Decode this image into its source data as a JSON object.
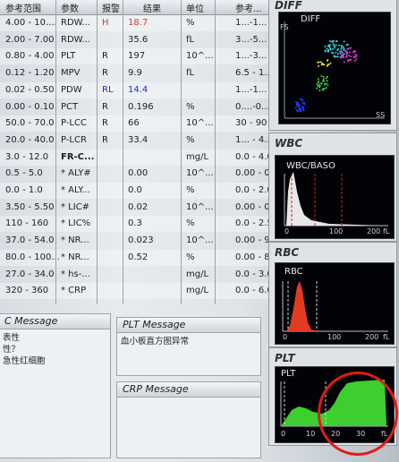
{
  "table": {
    "headers": {
      "range": "参考范围",
      "param": "参数",
      "flag": "报警",
      "result": "结果",
      "unit": "单位",
      "ref": "参考..."
    },
    "rows": [
      {
        "range": "4.00 - 10....",
        "param": "RDW...",
        "flag": "H",
        "result": "18.7",
        "unit": "%",
        "ref": "1...-1...",
        "flag_color": "red",
        "result_color": "red"
      },
      {
        "range": "2.00 - 7.00",
        "param": "RDW...",
        "flag": "",
        "result": "35.6",
        "unit": "fL",
        "ref": "3...-5..."
      },
      {
        "range": "0.80 - 4.00",
        "param": "PLT",
        "flag": "R",
        "result": "197",
        "unit": "10^...",
        "ref": "1...-3..."
      },
      {
        "range": "0.12 - 1.20",
        "param": "MPV",
        "flag": "R",
        "result": "9.9",
        "unit": "fL",
        "ref": "6.5 - 1..."
      },
      {
        "range": "0.02 - 0.50",
        "param": "PDW",
        "flag": "RL",
        "result": "14.4",
        "unit": "",
        "ref": "1...-1...",
        "flag_color": "blue",
        "result_color": "blue"
      },
      {
        "range": "0.00 - 0.10",
        "param": "PCT",
        "flag": "R",
        "result": "0.196",
        "unit": "%",
        "ref": "0....-0...."
      },
      {
        "range": "50.0 - 70.0",
        "param": "P-LCC",
        "flag": "R",
        "result": "66",
        "unit": "10^...",
        "ref": "30 - 90"
      },
      {
        "range": "20.0 - 40.0",
        "param": "P-LCR",
        "flag": "R",
        "result": "33.4",
        "unit": "%",
        "ref": "1... - 4..."
      },
      {
        "range": "3.0 - 12.0",
        "param": "FR-C...",
        "flag": "",
        "result": "",
        "unit": "mg/L",
        "ref": "0.0 - 4.0",
        "param_bold": true
      },
      {
        "range": "0.5 - 5.0",
        "param": "* ALY#",
        "flag": "",
        "result": "0.00",
        "unit": "10^...",
        "ref": "0.00 - 0..."
      },
      {
        "range": "0.0 - 1.0",
        "param": "* ALY...",
        "flag": "",
        "result": "0.0",
        "unit": "%",
        "ref": "0.0 - 2.0"
      },
      {
        "range": "3.50 - 5.50",
        "param": "* LIC#",
        "flag": "",
        "result": "0.02",
        "unit": "10^...",
        "ref": "0.00 - 0..."
      },
      {
        "range": "110 - 160",
        "param": "* LIC%",
        "flag": "",
        "result": "0.3",
        "unit": "%",
        "ref": "0.0 - 2.5"
      },
      {
        "range": "37.0 - 54.0",
        "param": "* NR...",
        "flag": "",
        "result": "0.023",
        "unit": "10^...",
        "ref": "0.00 - 9..."
      },
      {
        "range": "80.0 - 100...",
        "param": "* NR...",
        "flag": "",
        "result": "0.52",
        "unit": "%",
        "ref": "0.00 - 8..."
      },
      {
        "range": "27.0 - 34.0",
        "param": "* hs-...",
        "flag": "",
        "result": "",
        "unit": "mg/L",
        "ref": "0.0 - 3.0"
      },
      {
        "range": "320 - 360",
        "param": "* CRP",
        "flag": "",
        "result": "",
        "unit": "mg/L",
        "ref": "0.0 - 6.0"
      }
    ]
  },
  "messages": {
    "wbc": {
      "title": "C Message",
      "lines": [
        "表性",
        "性？",
        "急性红细胞"
      ]
    },
    "plt": {
      "title": "PLT Message",
      "lines": [
        "血小板直方图异常"
      ]
    },
    "crp": {
      "title": "CRP Message",
      "lines": []
    }
  },
  "graphs": {
    "diff": {
      "title": "DIFF",
      "label": "DIFF",
      "y_axis": "FS",
      "x_axis": "SS"
    },
    "wbc": {
      "title": "WBC",
      "label": "WBC/BASO",
      "ticks": [
        "0",
        "100",
        "200",
        "fL"
      ]
    },
    "rbc": {
      "title": "RBC",
      "label": "RBC",
      "ticks": [
        "0",
        "100",
        "200",
        "fL"
      ]
    },
    "plt": {
      "title": "PLT",
      "label": "PLT",
      "ticks": [
        "0",
        "10",
        "20",
        "30",
        "fL"
      ]
    }
  },
  "colors": {
    "high_flag": "#e23a2a",
    "low_flag": "#1c2fd0",
    "plt_curve": "#3ccf2f",
    "rbc_curve": "#e33a22",
    "annotation": "#e01b1b"
  }
}
